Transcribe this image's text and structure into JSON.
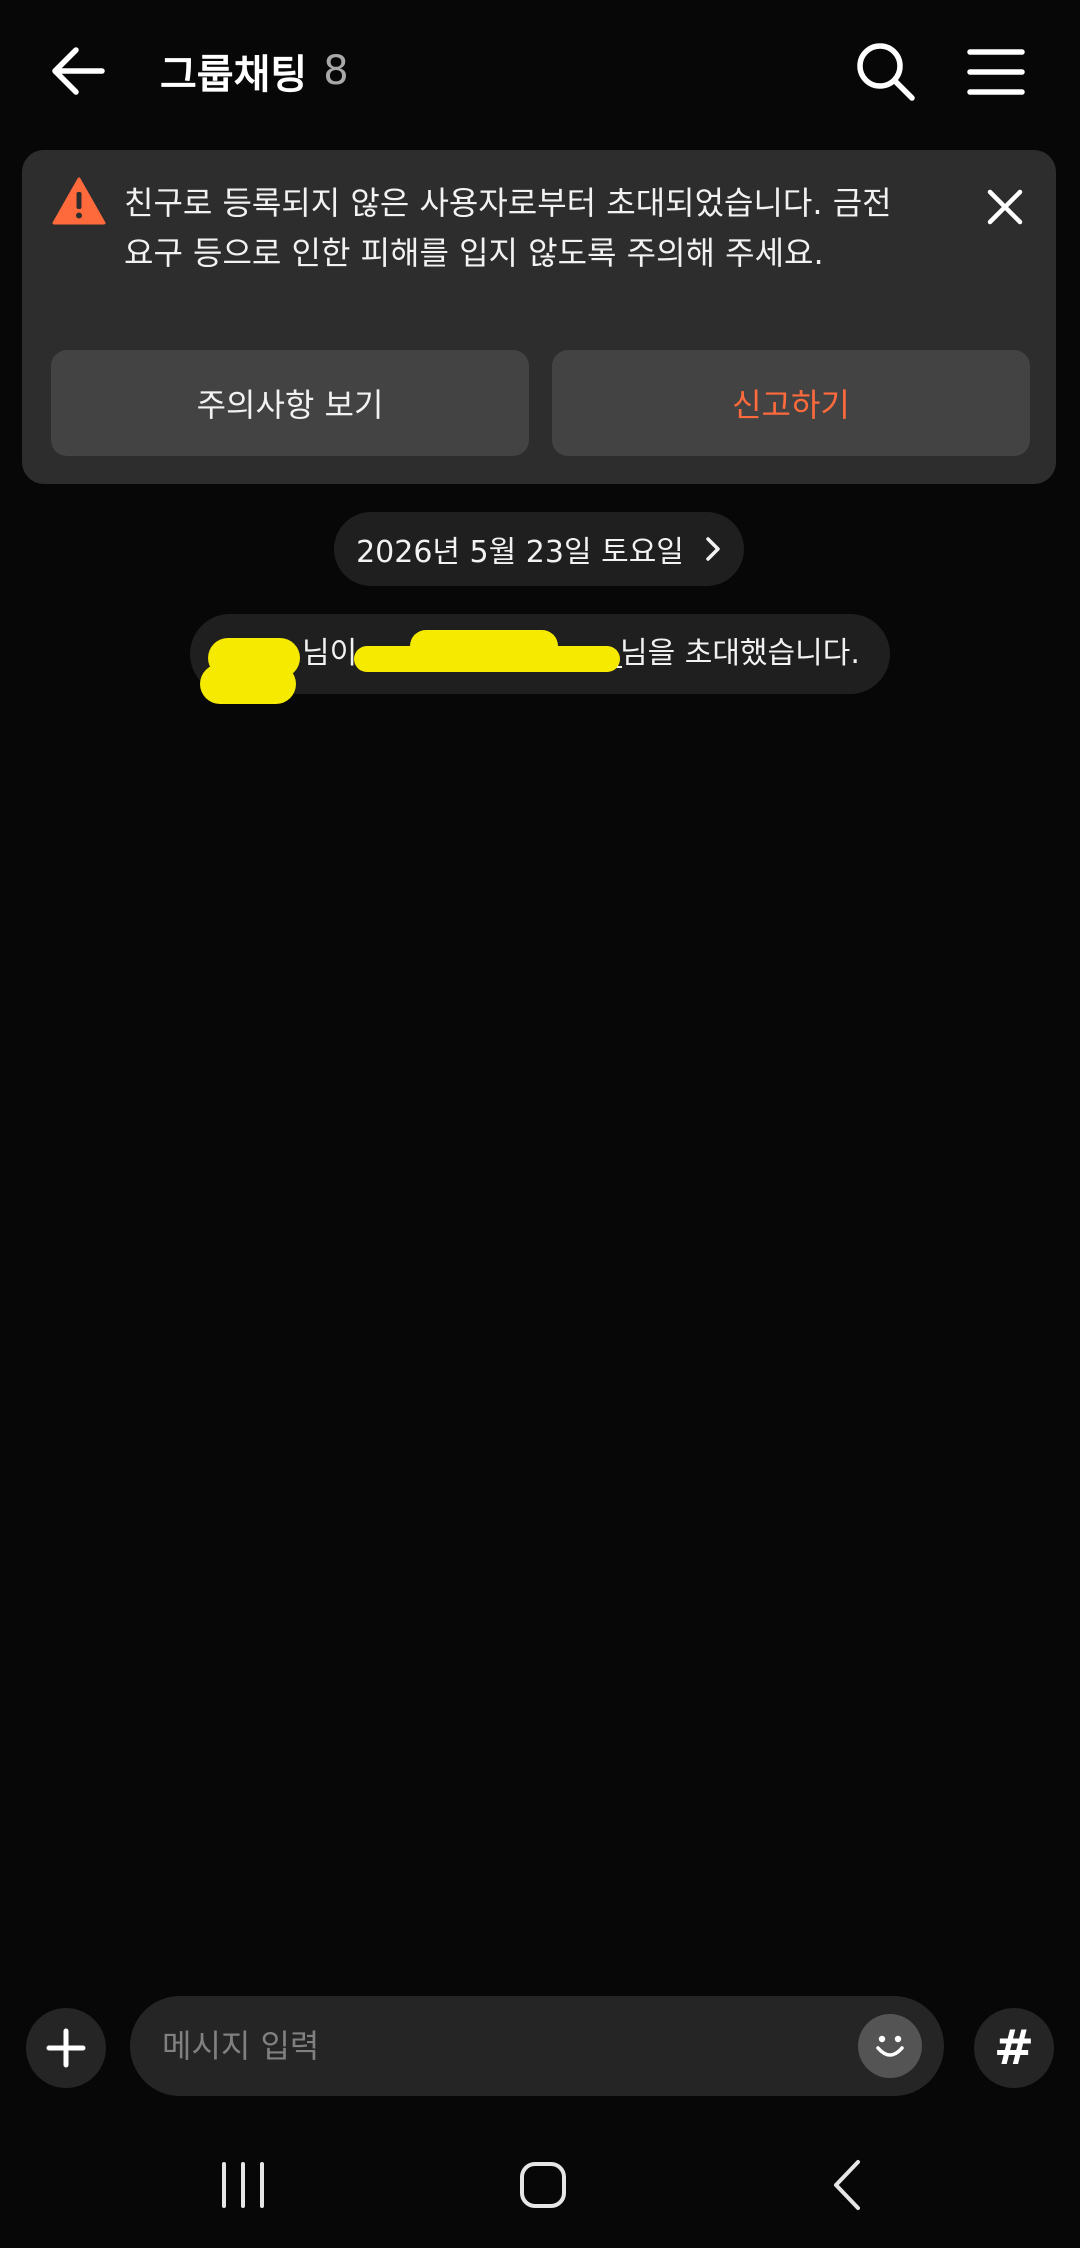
{
  "header": {
    "title": "그룹채팅",
    "member_count": "8",
    "icons": {
      "back": "arrow-left-icon",
      "search": "search-icon",
      "menu": "hamburger-menu-icon"
    }
  },
  "warning": {
    "message": "친구로 등록되지 않은 사용자로부터 초대되었습니다. 금전 요구 등으로 인한 피해를 입지 않도록 주의해 주세요.",
    "notice_label": "주의사항 보기",
    "report_label": "신고하기",
    "colors": {
      "accent": "#ff6a3d",
      "card": "#2d2d2d"
    }
  },
  "chat": {
    "date_label": "2026년 5월 23일 토요일",
    "system_message": {
      "inviter_suffix": "님이",
      "invitee_suffix": "님을 초대했습니다."
    }
  },
  "input": {
    "placeholder": "메시지 입력",
    "hash_label": "#"
  },
  "colors": {
    "background": "#070707",
    "redaction": "#f6ea00"
  }
}
